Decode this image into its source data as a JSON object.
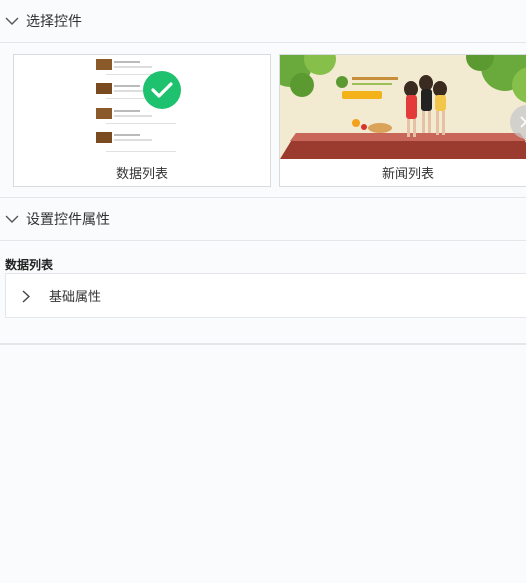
{
  "sections": {
    "select": {
      "title": "选择控件"
    },
    "props": {
      "title": "设置控件属性"
    }
  },
  "widgets": [
    {
      "label": "数据列表",
      "selected": true
    },
    {
      "label": "新闻列表",
      "selected": false
    }
  ],
  "panel": {
    "widget_name": "数据列表",
    "group": {
      "label": "基础属性"
    }
  },
  "colors": {
    "check": "#1ec16e",
    "border": "#e4e6ea"
  },
  "icons": [
    "chevron-down-icon",
    "check-icon",
    "chevron-right-icon"
  ]
}
